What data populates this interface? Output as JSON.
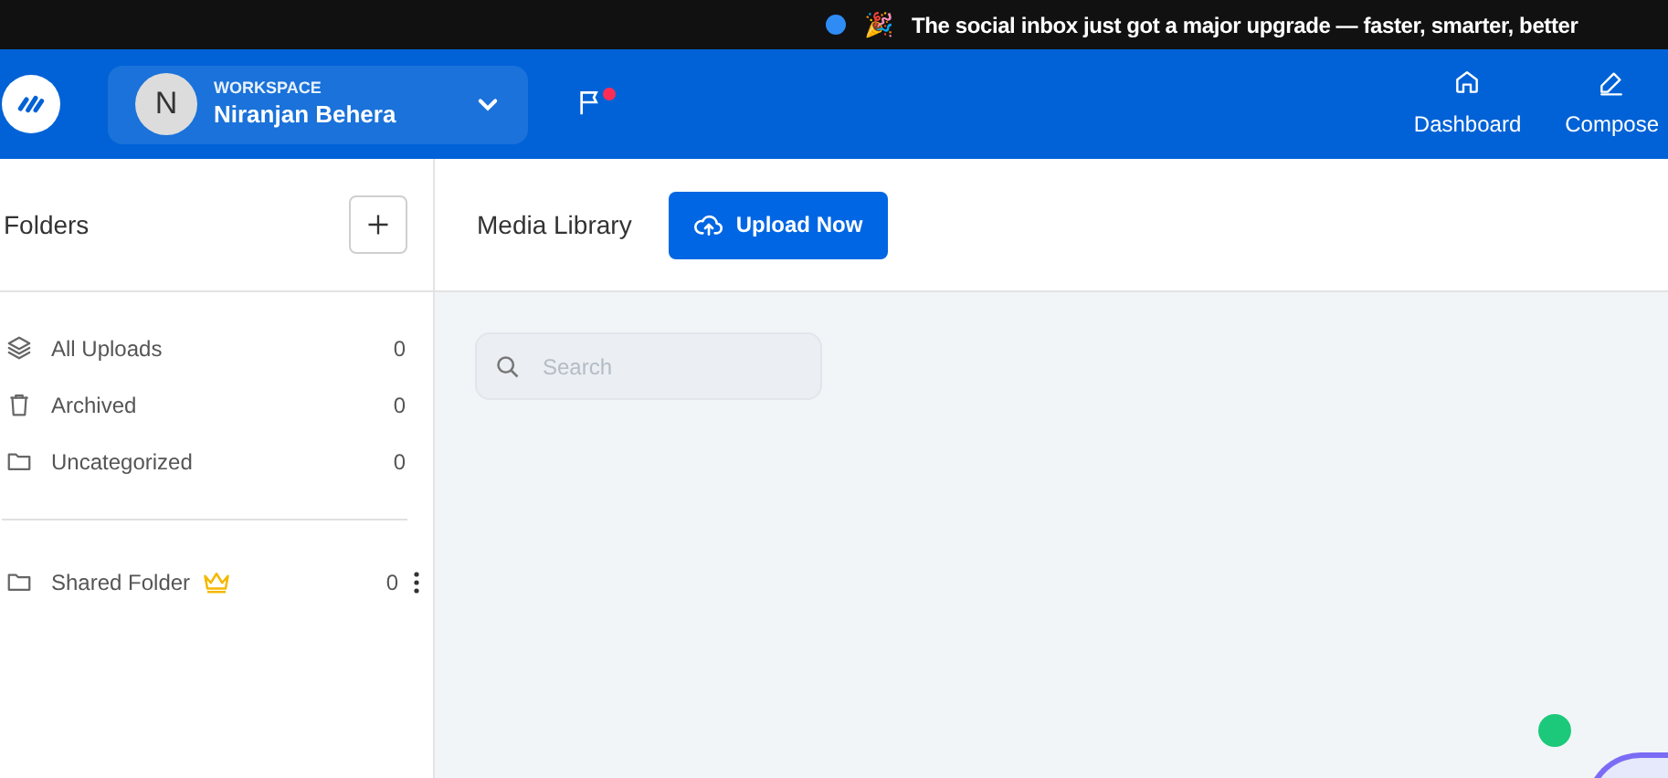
{
  "announcement": {
    "emoji": "🎉",
    "text": "The social inbox just got a major upgrade — faster, smarter, better"
  },
  "header": {
    "workspace": {
      "avatar": "N",
      "label": "WORKSPACE",
      "name": "Niranjan Behera"
    },
    "nav": [
      {
        "kind": "home",
        "label": "Dashboard"
      },
      {
        "kind": "pen",
        "label": "Compose"
      }
    ]
  },
  "sidebar": {
    "title": "Folders",
    "folders": [
      {
        "kind": "layers",
        "label": "All Uploads",
        "count": "0"
      },
      {
        "kind": "trash",
        "label": "Archived",
        "count": "0"
      },
      {
        "kind": "folder",
        "label": "Uncategorized",
        "count": "0"
      }
    ],
    "shared": [
      {
        "kind": "folder",
        "label": "Shared Folder",
        "count": "0",
        "premium": true
      }
    ]
  },
  "main": {
    "title": "Media Library",
    "upload_button": "Upload Now",
    "search": {
      "placeholder": "Search"
    }
  }
}
